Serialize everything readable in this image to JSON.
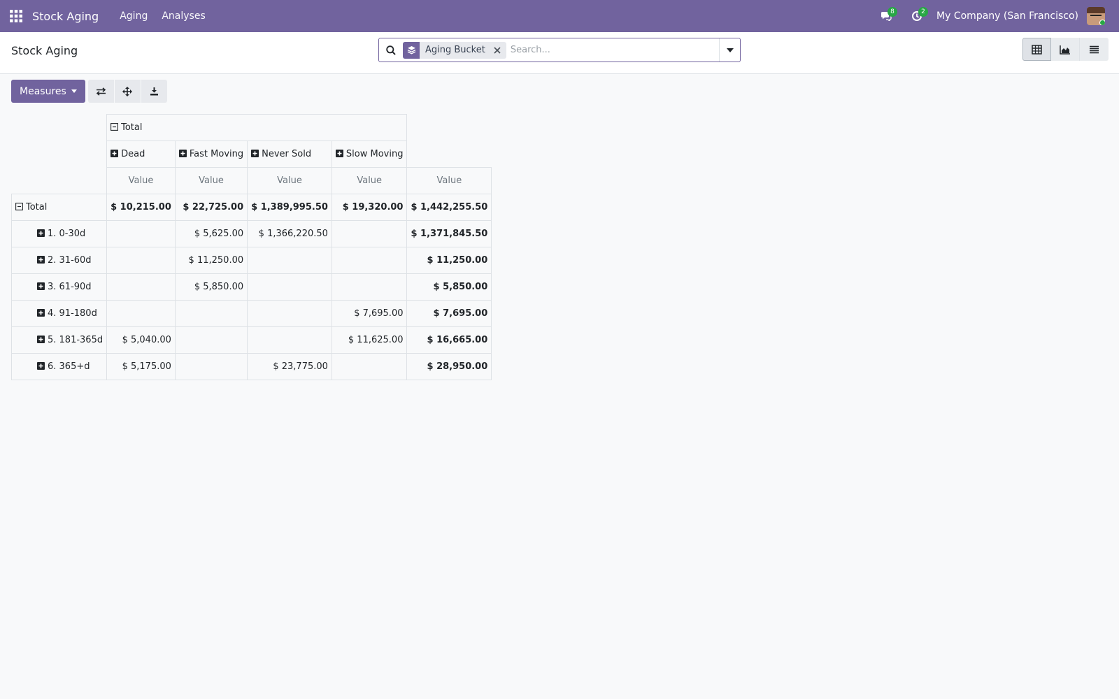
{
  "navbar": {
    "brand": "Stock Aging",
    "menus": [
      "Aging",
      "Analyses"
    ],
    "messages_badge": "8",
    "activities_badge": "2",
    "company": "My Company (San Francisco)"
  },
  "control_panel": {
    "title": "Stock Aging",
    "search": {
      "facet_label": "Aging Bucket",
      "placeholder": "Search..."
    },
    "views": [
      "pivot",
      "graph",
      "list"
    ],
    "active_view": "pivot"
  },
  "toolbar": {
    "measures_label": "Measures"
  },
  "pivot": {
    "col_group_header": "Total",
    "col_headers": [
      "Dead",
      "Fast Moving",
      "Never Sold",
      "Slow Moving"
    ],
    "measure_label": "Value",
    "total_row": {
      "label": "Total",
      "values": [
        "$ 10,215.00",
        "$ 22,725.00",
        "$ 1,389,995.50",
        "$ 19,320.00",
        "$ 1,442,255.50"
      ]
    },
    "rows": [
      {
        "label": "1. 0-30d",
        "values": [
          "",
          "$ 5,625.00",
          "$ 1,366,220.50",
          "",
          "$ 1,371,845.50"
        ]
      },
      {
        "label": "2. 31-60d",
        "values": [
          "",
          "$ 11,250.00",
          "",
          "",
          "$ 11,250.00"
        ]
      },
      {
        "label": "3. 61-90d",
        "values": [
          "",
          "$ 5,850.00",
          "",
          "",
          "$ 5,850.00"
        ]
      },
      {
        "label": "4. 91-180d",
        "values": [
          "",
          "",
          "",
          "$ 7,695.00",
          "$ 7,695.00"
        ]
      },
      {
        "label": "5. 181-365d",
        "values": [
          "$ 5,040.00",
          "",
          "",
          "$ 11,625.00",
          "$ 16,665.00"
        ]
      },
      {
        "label": "6. 365+d",
        "values": [
          "$ 5,175.00",
          "",
          "$ 23,775.00",
          "",
          "$ 28,950.00"
        ]
      }
    ]
  },
  "colors": {
    "brand": "#71639e",
    "badge": "#28a745"
  }
}
